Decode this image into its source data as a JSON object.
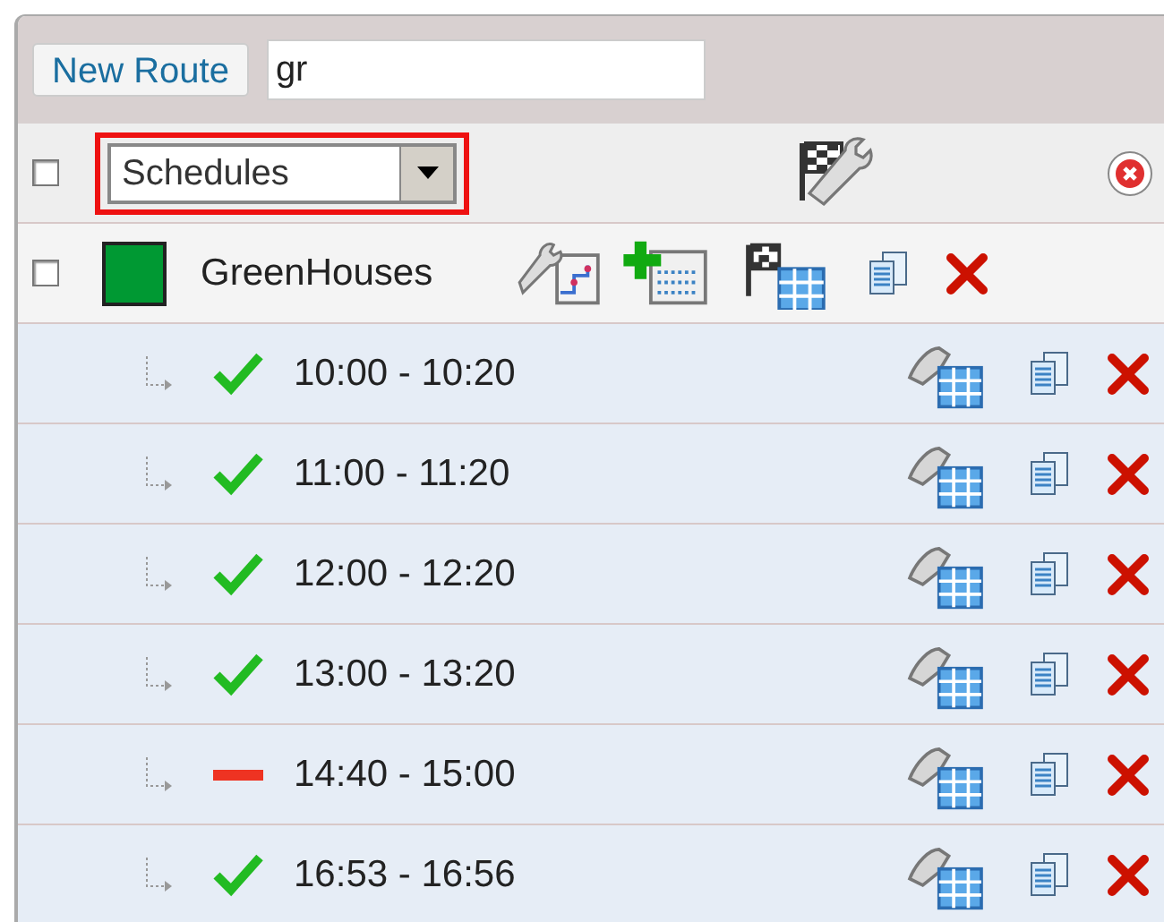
{
  "toolbar": {
    "new_route_button": "New Route",
    "search": {
      "value": "gr"
    }
  },
  "header": {
    "checked": false,
    "view_select": {
      "value": "Schedules",
      "highlighted": true
    }
  },
  "route": {
    "name": "GreenHouses",
    "checked": false,
    "color": "#009933"
  },
  "schedules": [
    {
      "time": "10:00 - 10:20",
      "kind": "active"
    },
    {
      "time": "11:00 - 11:20",
      "kind": "active"
    },
    {
      "time": "12:00 - 12:20",
      "kind": "active"
    },
    {
      "time": "13:00 - 13:20",
      "kind": "active"
    },
    {
      "time": "14:40 - 15:00",
      "kind": "inactive"
    },
    {
      "time": "16:53 - 16:56",
      "kind": "active"
    }
  ]
}
